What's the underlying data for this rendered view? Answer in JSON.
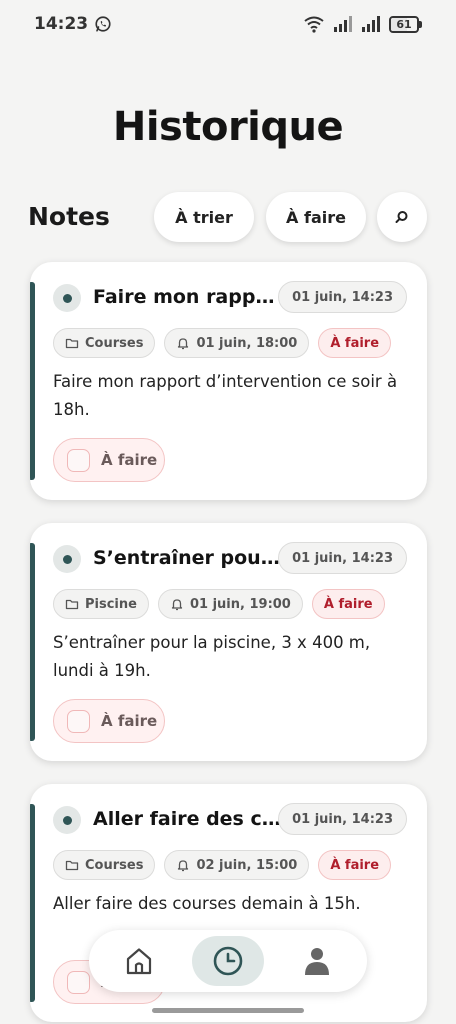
{
  "status_bar": {
    "time": "14:23",
    "battery": "61",
    "battery_level": 0.61
  },
  "title": "Historique",
  "notes_header": {
    "label": "Notes",
    "filter_to_sort": "À trier",
    "filter_todo": "À faire"
  },
  "cards": [
    {
      "title": "Faire mon rappo...",
      "date": "01 juin, 14:23",
      "category": "Courses",
      "reminder": "01 juin, 18:00",
      "status": "À faire",
      "body": "Faire mon rapport d’intervention ce soir à 18h.",
      "todo_label": "À faire"
    },
    {
      "title": "S’entraîner pour l...",
      "date": "01 juin, 14:23",
      "category": "Piscine",
      "reminder": "01 juin, 19:00",
      "status": "À faire",
      "body": "S’entraîner pour la piscine, 3 x 400 m, lundi à 19h.",
      "todo_label": "À faire"
    },
    {
      "title": "Aller faire des co...",
      "date": "01 juin, 14:23",
      "category": "Courses",
      "reminder": "02 juin, 15:00",
      "status": "À faire",
      "body": "Aller faire des courses demain à 15h.",
      "todo_label": "À faire"
    }
  ],
  "colors": {
    "accent": "#2f5556",
    "status_red": "#b01e2c"
  }
}
